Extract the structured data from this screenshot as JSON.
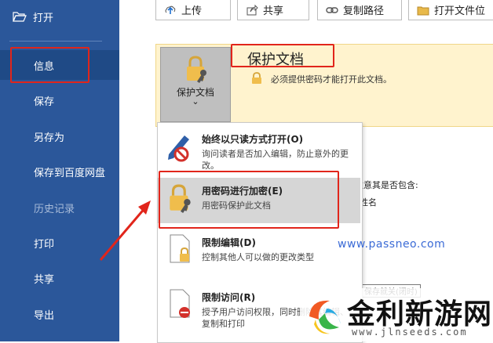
{
  "sidebar": {
    "open_label": "打开",
    "items": [
      {
        "label": "信息"
      },
      {
        "label": "保存"
      },
      {
        "label": "另存为"
      },
      {
        "label": "保存到百度网盘"
      },
      {
        "label": "历史记录"
      },
      {
        "label": "打印"
      },
      {
        "label": "共享"
      },
      {
        "label": "导出"
      }
    ]
  },
  "toolbar": {
    "upload_label": "上传",
    "share_label": "共享",
    "copy_path_label": "复制路径",
    "open_location_label": "打开文件位"
  },
  "protect": {
    "tile_label": "保护文档",
    "tile_chevron": "⌄",
    "title": "保护文档",
    "description": "必须提供密码才能打开此文档。"
  },
  "menu": {
    "items": [
      {
        "title": "始终以只读方式打开(O)",
        "desc": "询问读者是否加入编辑，防止意外的更改。",
        "icon": "no-edit-pencil-icon"
      },
      {
        "title": "用密码进行加密(E)",
        "desc": "用密码保护此文档",
        "icon": "lock-key-icon"
      },
      {
        "title": "限制编辑(D)",
        "desc": "控制其他人可以做的更改类型",
        "icon": "document-lock-icon"
      },
      {
        "title": "限制访问(R)",
        "desc": "授予用户访问权限，同时删除其编辑、复制和打印",
        "icon": "document-restricted-icon"
      }
    ]
  },
  "background": {
    "text1": "注意其是否包含:",
    "text2": "姓名",
    "text3": "保存就关(闭时)"
  },
  "watermark": "www.passneo.com",
  "logo": {
    "text": "金利新游网",
    "sub": "www.jlnseeds.com"
  },
  "colors": {
    "sidebar": "#2b579a",
    "highlight": "#e1251b",
    "panel": "#fff3ce"
  }
}
